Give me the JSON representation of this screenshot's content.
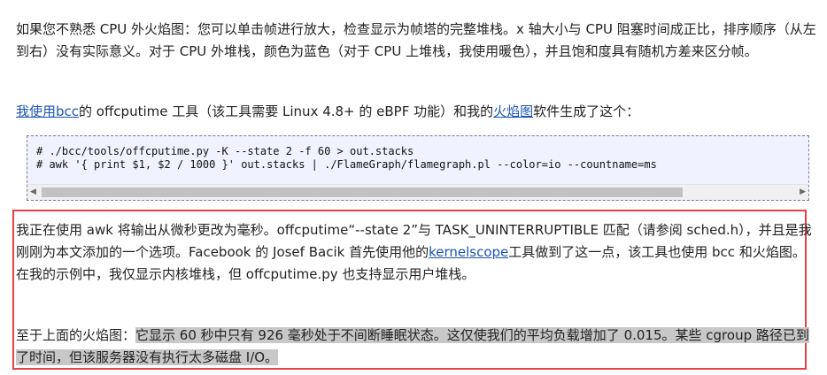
{
  "para1": "如果您不熟悉 CPU 外火焰图：您可以单击帧进行放大，检查显示为帧塔的完整堆栈。x 轴大小与 CPU 阻塞时间成正比，排序顺序（从左到右）没有实际意义。对于 CPU 外堆栈，颜色为蓝色（对于 CPU 上堆栈，我使用暖色），并且饱和度具有随机方差来区分帧。",
  "para2": {
    "link1": "我使用bcc",
    "text1": "的 offcputime 工具（该工具需要 Linux 4.8+ 的 eBPF 功能）和我的",
    "link2": "火焰图",
    "text2": "软件生成了这个："
  },
  "code": {
    "line1": "# ./bcc/tools/offcputime.py -K --state 2 -f 60 > out.stacks",
    "line2": "# awk '{ print $1, $2 / 1000 }' out.stacks | ./FlameGraph/flamegraph.pl --color=io --countname=ms"
  },
  "para3": {
    "text1": "我正在使用 awk 将输出从微秒更改为毫秒。offcputime“--state 2”与 TASK_UNINTERRUPTIBLE 匹配（请参阅 sched.h），并且是我刚刚为本文添加的一个选项。Facebook 的 Josef Bacik 首先使用他的",
    "link": "kernelscope",
    "text2": "工具做到了这一点，该工具也使用 bcc 和火焰图。在我的示例中，我仅显示内核堆栈，但 offcputime.py 也支持显示用户堆栈。"
  },
  "para4": {
    "text1": "至于上面的火焰图：",
    "highlight": "它显示 60 秒中只有 926 毫秒处于不间断睡眠状态。这仅使我们的平均负载增加了 0.015。某些 cgroup 路径已到了时间，但该服务器没有执行太多磁盘 I/O。"
  },
  "scrollbar": {
    "left_arrow": "◀",
    "right_arrow": "▶"
  }
}
